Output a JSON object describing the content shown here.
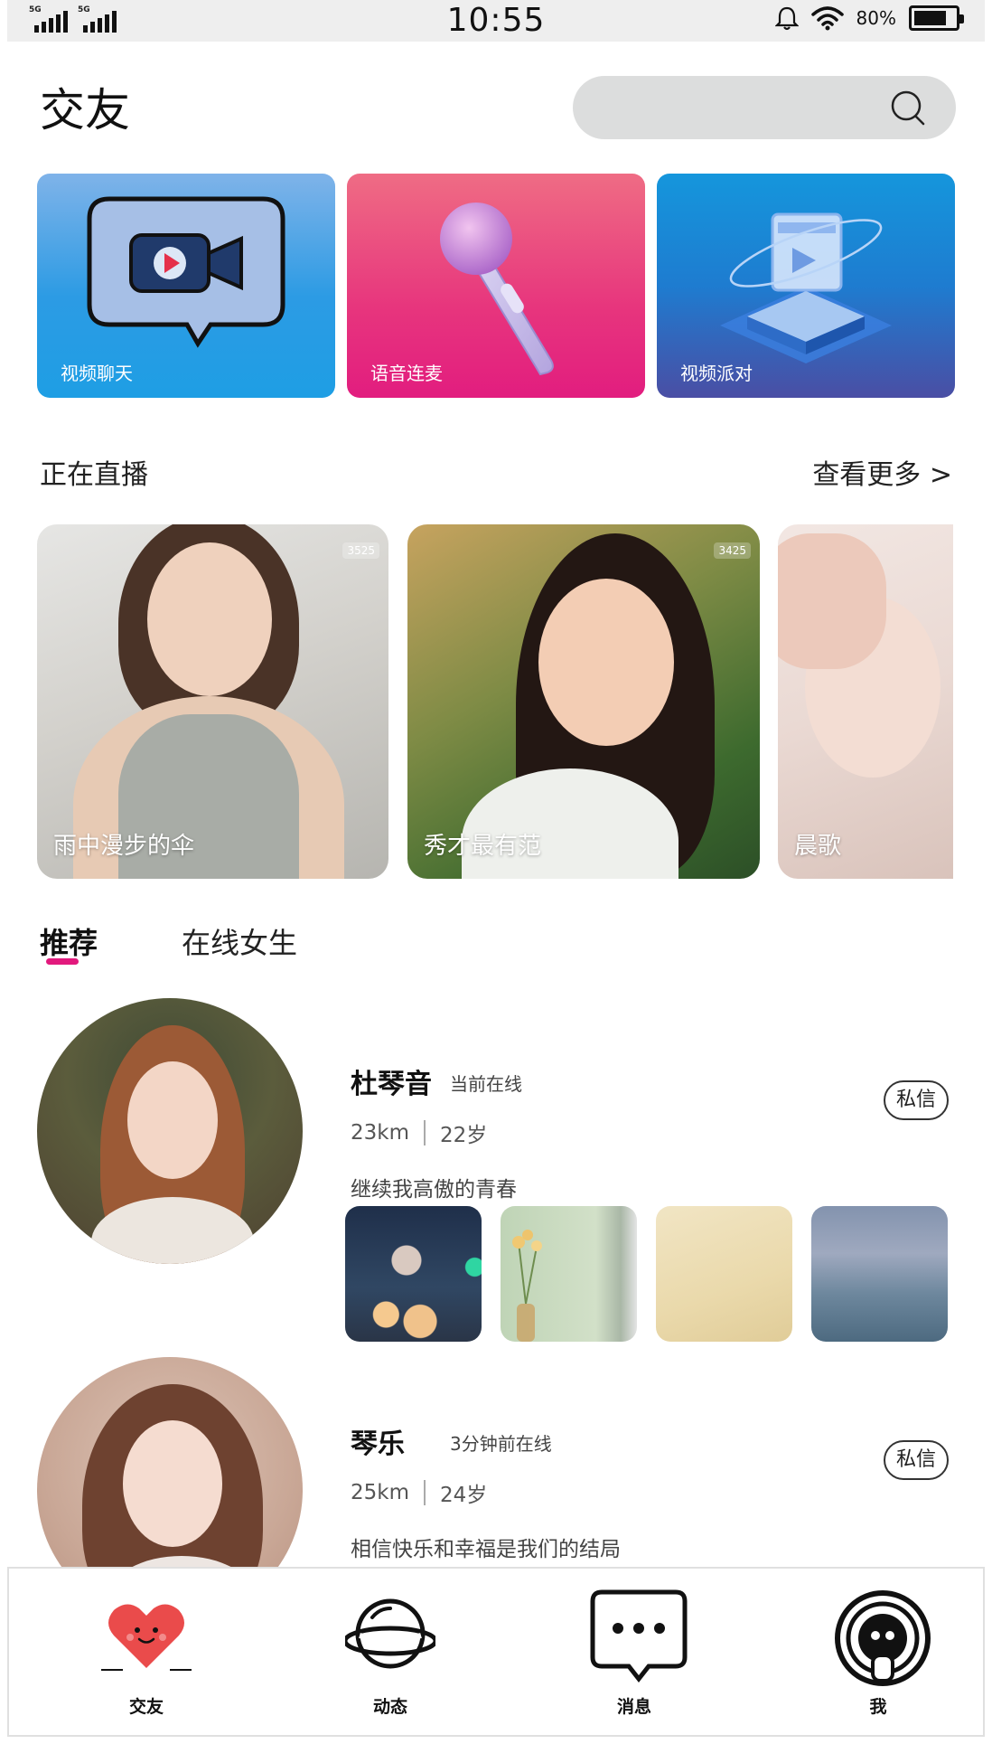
{
  "status_bar": {
    "signal1_label": "5G",
    "signal2_label": "5G",
    "time": "10:55",
    "battery_percent": "80%",
    "battery_level": 0.8
  },
  "header": {
    "title": "交友",
    "search_placeholder": ""
  },
  "features": [
    {
      "label": "视频聊天",
      "icon": "video-chat-icon"
    },
    {
      "label": "语音连麦",
      "icon": "microphone-icon"
    },
    {
      "label": "视频派对",
      "icon": "video-party-icon"
    }
  ],
  "live_section": {
    "title": "正在直播",
    "more": "查看更多 >",
    "rooms": [
      {
        "name": "雨中漫步的伞",
        "viewers": "3525"
      },
      {
        "name": "秀才最有范",
        "viewers": "3425"
      },
      {
        "name": "晨歌",
        "viewers": ""
      }
    ]
  },
  "tabs": {
    "recommend": "推荐",
    "online_girls": "在线女生"
  },
  "users": [
    {
      "name": "杜琴音",
      "status": "当前在线",
      "distance": "23km",
      "age": "22岁",
      "bio": "继续我高傲的青春",
      "dm": "私信"
    },
    {
      "name": "琴乐",
      "status": "3分钟前在线",
      "distance": "25km",
      "age": "24岁",
      "bio": "相信快乐和幸福是我们的结局",
      "dm": "私信"
    }
  ],
  "bottom_nav": [
    {
      "label": "交友",
      "icon": "heart-face-icon"
    },
    {
      "label": "动态",
      "icon": "planet-icon"
    },
    {
      "label": "消息",
      "icon": "chat-bubble-icon"
    },
    {
      "label": "我",
      "icon": "profile-icon"
    }
  ],
  "colors": {
    "accent": "#e2197d",
    "search_bg": "#dcdddd",
    "status_bar_bg": "#eeeeee",
    "nav_heart": "#ea4b4b"
  }
}
